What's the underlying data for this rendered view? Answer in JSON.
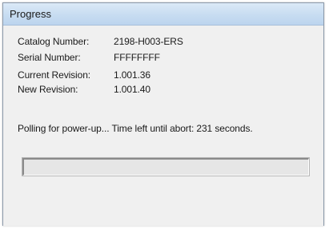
{
  "window": {
    "title": "Progress"
  },
  "info": {
    "catalog_label": "Catalog Number:",
    "catalog_value": "2198-H003-ERS",
    "serial_label": "Serial Number:",
    "serial_value": "FFFFFFFF",
    "current_label": "Current Revision:",
    "current_value": "1.001.36",
    "new_label": "New Revision:",
    "new_value": "1.001.40"
  },
  "status": {
    "message": "Polling for power-up... Time left until abort: 231 seconds."
  },
  "progress": {
    "fraction": 0
  },
  "colors": {
    "titlebar": "#c7dcf1",
    "background": "#f0f0f0"
  }
}
